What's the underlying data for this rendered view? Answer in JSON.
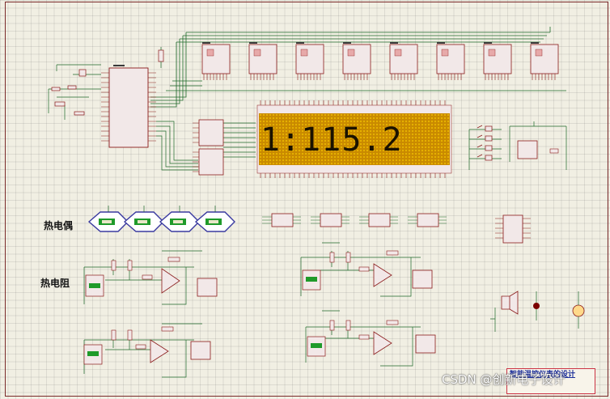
{
  "labels": {
    "thermocouple": "热电偶",
    "rtd": "热电阻"
  },
  "lcd": {
    "display_text": "1:115.2"
  },
  "title_block": {
    "project_title": "智能温控仪表的设计"
  },
  "watermark": "CSDN @创新电子设计",
  "colors": {
    "sheet_bg": "#f1efe3",
    "wire": "#1e6a2a",
    "chip_body": "#f2e8e8",
    "chip_border": "#8a1a1a",
    "lcd_bg": "#c98a00",
    "lcd_dot_on": "#1a1200",
    "terminal_green": "#1f9a2a"
  }
}
